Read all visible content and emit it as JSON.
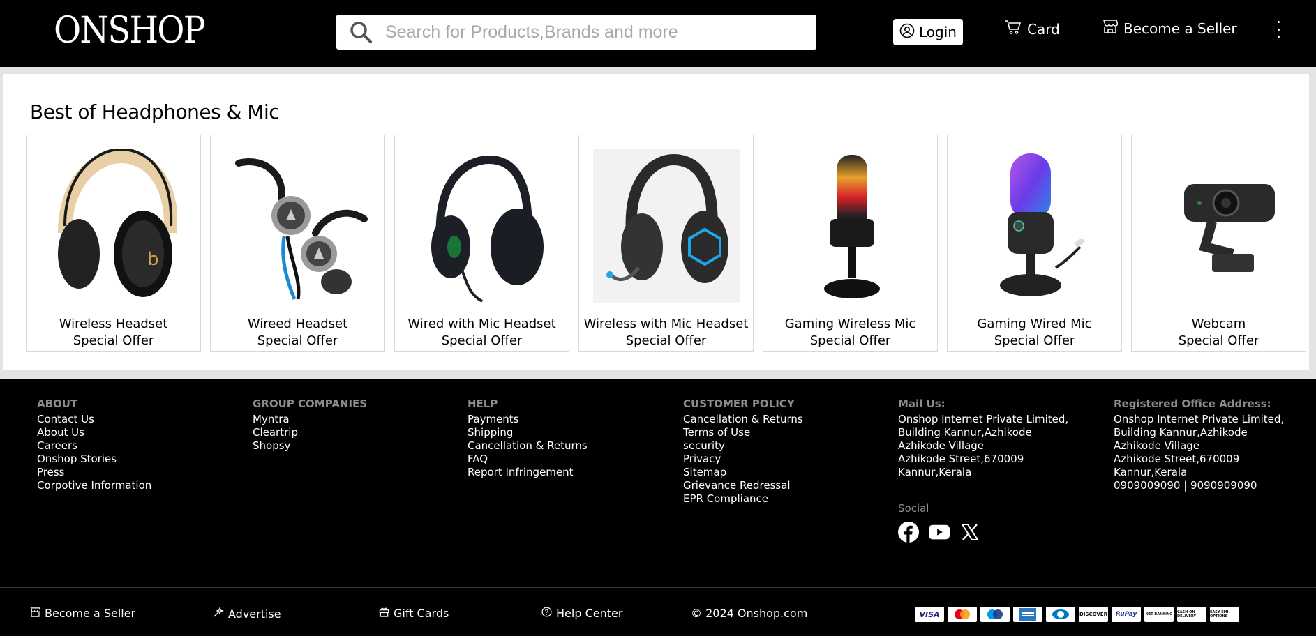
{
  "header": {
    "logo": "ONSHOP",
    "search_placeholder": "Search for Products,Brands and more",
    "login_label": "Login",
    "cart_label": "Card",
    "seller_label": "Become a Seller"
  },
  "main": {
    "section_title": "Best of Headphones & Mic",
    "products": [
      {
        "name": "Wireless Headset",
        "offer": "Special Offer",
        "icon": "wireless-headset-image"
      },
      {
        "name": "Wireed Headset",
        "offer": "Special Offer",
        "icon": "wired-earphones-image"
      },
      {
        "name": "Wired with Mic Headset",
        "offer": "Special Offer",
        "icon": "wired-mic-headset-image"
      },
      {
        "name": "Wireless with Mic Headset",
        "offer": "Special Offer",
        "icon": "wireless-mic-headset-image"
      },
      {
        "name": "Gaming Wireless Mic",
        "offer": "Special Offer",
        "icon": "gaming-wireless-mic-image"
      },
      {
        "name": "Gaming Wired Mic",
        "offer": "Special Offer",
        "icon": "gaming-wired-mic-image"
      },
      {
        "name": "Webcam",
        "offer": "Special Offer",
        "icon": "webcam-image"
      }
    ]
  },
  "footer": {
    "about": {
      "heading": "ABOUT",
      "links": [
        "Contact Us",
        "About Us",
        "Careers",
        "Onshop Stories",
        "Press",
        "Corpotive Information"
      ]
    },
    "group": {
      "heading": "GROUP COMPANIES",
      "links": [
        "Myntra",
        "Cleartrip",
        "Shopsy"
      ]
    },
    "help": {
      "heading": "HELP",
      "links": [
        "Payments",
        "Shipping",
        "Cancellation & Returns",
        "FAQ",
        "Report Infringement"
      ]
    },
    "policy": {
      "heading": "CUSTOMER POLICY",
      "links": [
        "Cancellation & Returns",
        "Terms of Use",
        "security",
        "Privacy",
        "Sitemap",
        "Grievance Redressal",
        "EPR Compliance"
      ]
    },
    "mail": {
      "heading": "Mail Us:",
      "lines": [
        "Onshop Internet Private Limited,",
        "Building Kannur,Azhikode",
        "Azhikode Village",
        "Azhikode Street,670009",
        "Kannur,Kerala"
      ]
    },
    "office": {
      "heading": "Registered Office Address:",
      "lines": [
        "Onshop Internet Private Limited,",
        "Building Kannur,Azhikode",
        "Azhikode Village",
        "Azhikode Street,670009",
        "Kannur,Kerala",
        "0909009090 | 9090909090"
      ]
    },
    "social_heading": "Social",
    "bottom": {
      "seller": "Become a Seller",
      "advertise": "Advertise",
      "gift": "Gift Cards",
      "help_center": "Help Center",
      "copyright": "© 2024 Onshop.com"
    },
    "payments": [
      "VISA",
      "Mastercard",
      "Maestro",
      "AmEx",
      "Diners",
      "DISCOVER",
      "RuPay",
      "NET BANKING",
      "CASH ON DELIVERY",
      "EASY EMI OPTIONS"
    ]
  }
}
